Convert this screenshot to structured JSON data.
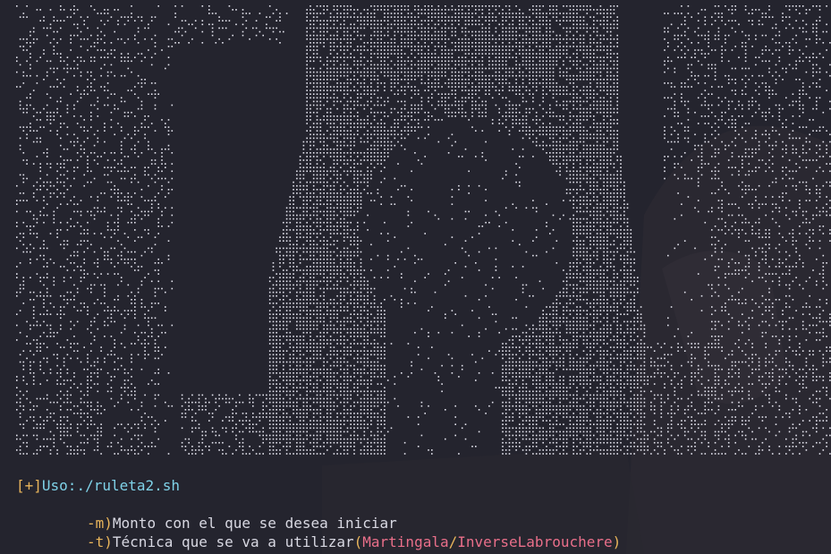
{
  "terminal": {
    "usage": {
      "prefix": "[+]",
      "text": "Uso:./ruleta2.sh"
    },
    "options": [
      {
        "flag": "-m)",
        "description": "Monto con el que se desea iniciar"
      },
      {
        "flag": "-t)",
        "description": "Técnica que se va a utilizar",
        "paren_open": "(",
        "choices": [
          "Martingala",
          "InverseLabrouchere"
        ],
        "separator": "/",
        "paren_close": ")"
      }
    ]
  },
  "colors": {
    "background": "#24242e",
    "ascii_dots": "#e6e6f0",
    "prefix": "#e9b55b",
    "command": "#7fd2e8",
    "flag": "#e9b55b",
    "description": "#d8d8e2",
    "choice": "#ea6f8a"
  },
  "icons": {
    "ascii_art": "braille-portrait-art",
    "wallpaper": "dark-anime-wallpaper"
  }
}
